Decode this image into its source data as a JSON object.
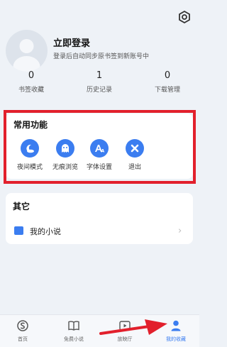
{
  "profile": {
    "title": "立即登录",
    "subtitle": "登录后自动同步原书签到新账号中"
  },
  "stats": [
    {
      "value": "0",
      "label": "书签收藏"
    },
    {
      "value": "1",
      "label": "历史记录"
    },
    {
      "value": "0",
      "label": "下载管理"
    }
  ],
  "functions": {
    "title": "常用功能",
    "items": [
      {
        "label": "夜间模式",
        "icon": "night-mode-icon"
      },
      {
        "label": "无痕浏览",
        "icon": "ghost-icon"
      },
      {
        "label": "字体设置",
        "icon": "font-icon"
      },
      {
        "label": "退出",
        "icon": "close-icon"
      }
    ]
  },
  "other": {
    "title": "其它",
    "novel_label": "我的小说"
  },
  "tabs": [
    {
      "label": "首页",
      "icon": "home-icon"
    },
    {
      "label": "免费小说",
      "icon": "book-icon"
    },
    {
      "label": "放映厅",
      "icon": "video-icon"
    },
    {
      "label": "我的收藏",
      "icon": "user-icon",
      "active": true
    }
  ],
  "colors": {
    "accent": "#3b7df0",
    "highlight_frame": "#e2202c",
    "arrow": "#e2202c"
  }
}
